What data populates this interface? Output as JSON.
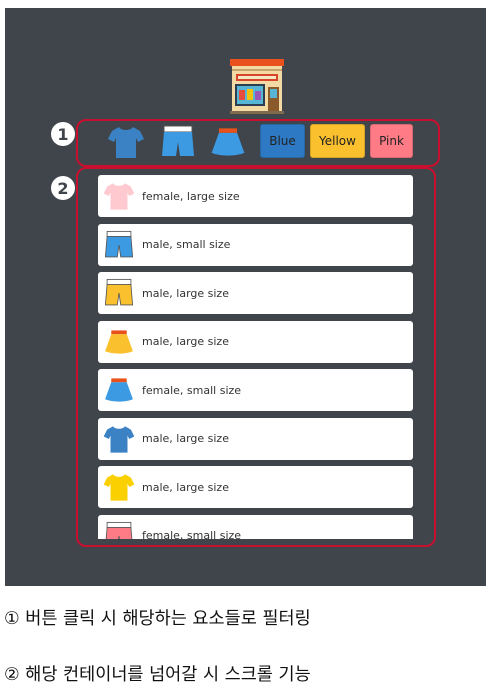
{
  "markers": {
    "one": "1",
    "two": "2"
  },
  "filters": {
    "buttons": [
      {
        "icon": "tshirt-icon",
        "color": "#3b82c4"
      },
      {
        "icon": "pants-icon",
        "color": "#3b9ae1"
      },
      {
        "icon": "skirt-icon",
        "color": "#3b9ae1"
      }
    ],
    "blue": "Blue",
    "yellow": "Yellow",
    "pink": "Pink",
    "colors": {
      "blue": "#2d79c4",
      "yellow": "#fbc02d",
      "pink": "#ff7b85"
    }
  },
  "items": [
    {
      "icon": "tshirt-icon",
      "color": "#ffc9d0",
      "text": "female, large size"
    },
    {
      "icon": "pants-icon",
      "color": "#3b9ae1",
      "text": "male, small size"
    },
    {
      "icon": "pants-icon",
      "color": "#fbc02d",
      "text": "male, large size"
    },
    {
      "icon": "skirt-icon",
      "color": "#fbc02d",
      "text": "male, large size"
    },
    {
      "icon": "skirt-icon",
      "color": "#3b9ae1",
      "text": "female, small size"
    },
    {
      "icon": "tshirt-icon",
      "color": "#3b82c4",
      "text": "male, large size"
    },
    {
      "icon": "tshirt-icon",
      "color": "#fbd000",
      "text": "male, large size"
    },
    {
      "icon": "pants-icon",
      "color": "#ff7b85",
      "text": "female, small size"
    }
  ],
  "captions": {
    "one": "① 버튼 클릭 시 해당하는 요소들로 필터링",
    "two": "② 해당 컨테이너를 넘어갈 시 스크롤 기능"
  }
}
